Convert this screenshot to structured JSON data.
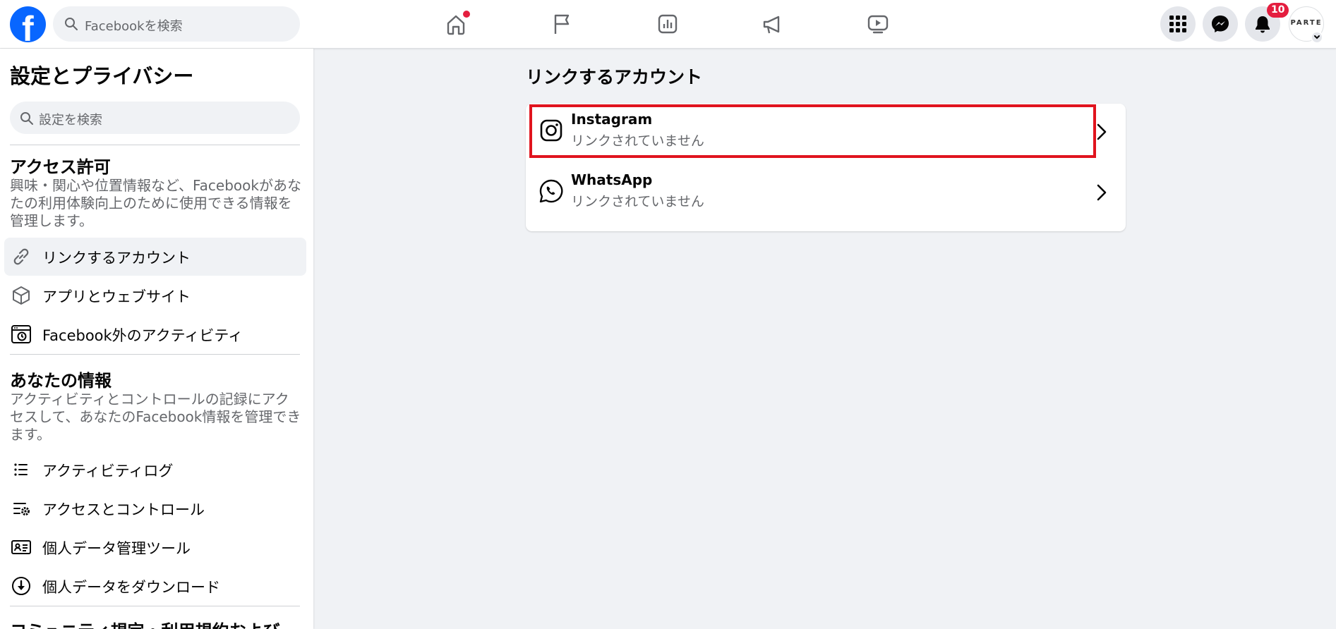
{
  "header": {
    "search_placeholder": "Facebookを検索",
    "notification_count": "10",
    "avatar_text": "PARTE"
  },
  "sidebar": {
    "title": "設定とプライバシー",
    "search_placeholder": "設定を検索",
    "sections": [
      {
        "title": "アクセス許可",
        "description": "興味・関心や位置情報など、Facebookがあなたの利用体験向上のために使用できる情報を管理します。",
        "items": [
          {
            "label": "リンクするアカウント",
            "icon": "link-icon",
            "active": true
          },
          {
            "label": "アプリとウェブサイト",
            "icon": "cube-icon"
          },
          {
            "label": "Facebook外のアクティビティ",
            "icon": "history-icon"
          }
        ]
      },
      {
        "title": "あなたの情報",
        "description": "アクティビティとコントロールの記録にアクセスして、あなたのFacebook情報を管理できます。",
        "items": [
          {
            "label": "アクティビティログ",
            "icon": "list-icon"
          },
          {
            "label": "アクセスとコントロール",
            "icon": "list-gear-icon"
          },
          {
            "label": "個人データ管理ツール",
            "icon": "id-card-icon"
          },
          {
            "label": "個人データをダウンロード",
            "icon": "download-icon"
          }
        ]
      },
      {
        "title": "コミュニティ規定・利用規約および"
      }
    ]
  },
  "main": {
    "title": "リンクするアカウント",
    "accounts": [
      {
        "name": "Instagram",
        "status": "リンクされていません",
        "icon": "instagram-icon",
        "highlighted": true
      },
      {
        "name": "WhatsApp",
        "status": "リンクされていません",
        "icon": "whatsapp-icon"
      }
    ]
  },
  "colors": {
    "brand": "#0866ff",
    "highlight": "#e0141e",
    "badge": "#e41e3f"
  }
}
